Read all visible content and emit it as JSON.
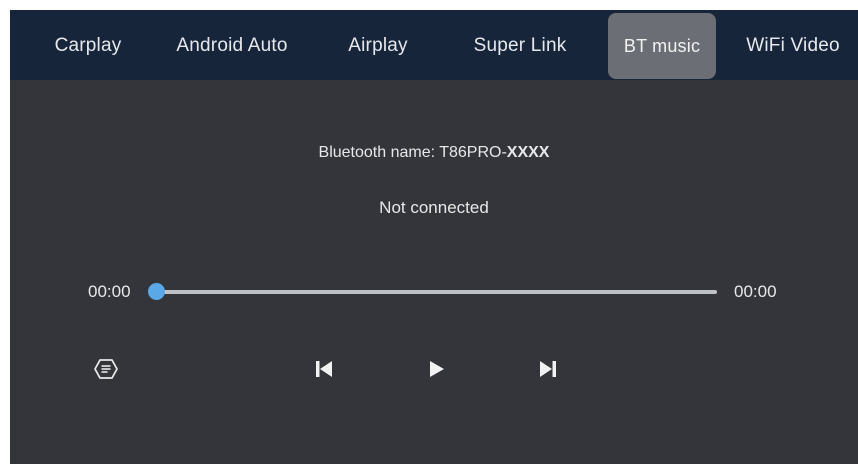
{
  "tabs": [
    {
      "id": "carplay",
      "label": "Carplay",
      "active": false
    },
    {
      "id": "android-auto",
      "label": "Android Auto",
      "active": false
    },
    {
      "id": "airplay",
      "label": "Airplay",
      "active": false
    },
    {
      "id": "super-link",
      "label": "Super Link",
      "active": false
    },
    {
      "id": "bt-music",
      "label": "BT music",
      "active": true
    },
    {
      "id": "wifi-video",
      "label": "WiFi Video",
      "active": false
    }
  ],
  "bluetooth": {
    "name_label": "Bluetooth name: T86PRO-",
    "name_suffix": "XXXX",
    "status": "Not connected"
  },
  "player": {
    "elapsed": "00:00",
    "duration": "00:00",
    "progress": 0
  },
  "controls": {
    "playlist_icon": "playlist-icon",
    "prev_icon": "skip-previous-icon",
    "play_icon": "play-icon",
    "next_icon": "skip-next-icon"
  },
  "colors": {
    "background": "#34353a",
    "tab_bar": "#17253b",
    "active_tab": "#6b6e74",
    "accent": "#5aa9e6",
    "track": "#bfc2c7",
    "text": "#e8e8ea"
  }
}
